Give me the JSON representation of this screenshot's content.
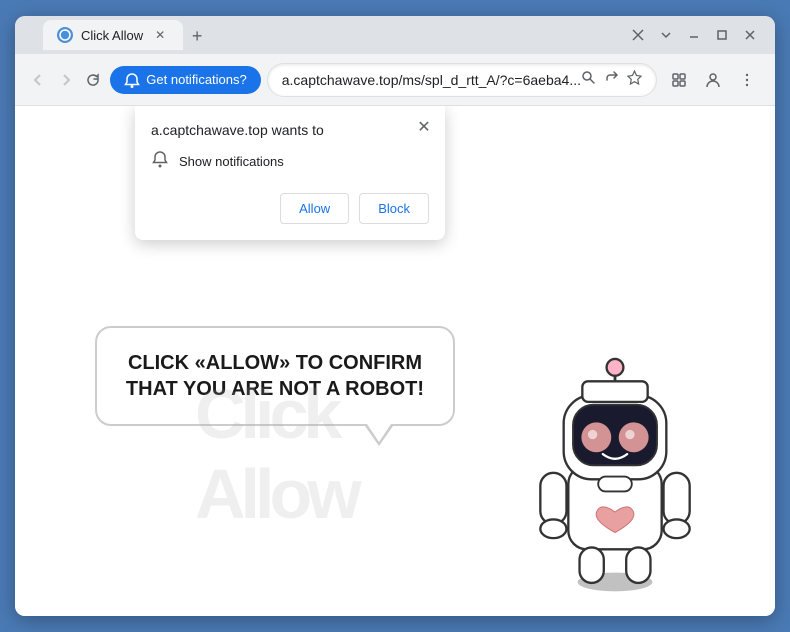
{
  "browser": {
    "title": "Click Allow",
    "tab_label": "Click Allow",
    "url": "a.captchawave.top/ms/spl_d_rtt_A/?c=6aeba4...",
    "new_tab_icon": "+",
    "back_icon": "←",
    "forward_icon": "→",
    "refresh_icon": "↻",
    "notification_button_label": "Get notifications?",
    "minimize_icon": "—",
    "maximize_icon": "□",
    "close_icon": "✕",
    "tab_close_icon": "✕",
    "search_icon": "🔍",
    "share_icon": "⎙",
    "bookmark_icon": "☆",
    "extensions_icon": "⧉",
    "profile_icon": "👤",
    "menu_icon": "⋮"
  },
  "notification_popup": {
    "title": "a.captchawave.top wants to",
    "notification_item": "Show notifications",
    "allow_label": "Allow",
    "block_label": "Block",
    "close_icon": "✕"
  },
  "page": {
    "bubble_text": "CLICK «ALLOW» TO CONFIRM THAT YOU ARE NOT A ROBOT!",
    "watermark_text": "Click Allow"
  }
}
